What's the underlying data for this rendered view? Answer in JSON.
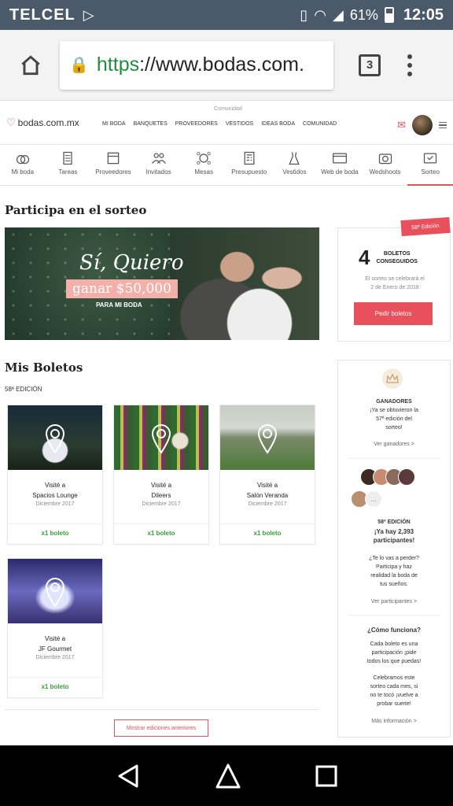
{
  "status_bar": {
    "carrier": "TELCEL",
    "battery": "61%",
    "time": "12:05"
  },
  "browser": {
    "url_scheme": "https",
    "url_rest": "://www.bodas.com.",
    "tab_count": "3"
  },
  "site": {
    "logo_text": "bodas.com.mx",
    "top_small": "Comunidad",
    "nav": [
      "MI BODA",
      "BANQUETES",
      "PROVEEDORES",
      "VESTIDOS",
      "IDEAS BODA",
      "COMUNIDAD"
    ]
  },
  "tools": [
    {
      "label": "Mi boda",
      "icon": "rings-icon"
    },
    {
      "label": "Tareas",
      "icon": "checklist-icon"
    },
    {
      "label": "Proveedores",
      "icon": "vendors-icon"
    },
    {
      "label": "Invitados",
      "icon": "guests-icon"
    },
    {
      "label": "Mesas",
      "icon": "tables-icon"
    },
    {
      "label": "Presupuesto",
      "icon": "budget-icon"
    },
    {
      "label": "Vestidos",
      "icon": "dress-icon"
    },
    {
      "label": "Web de boda",
      "icon": "website-icon"
    },
    {
      "label": "Wedshoots",
      "icon": "camera-icon"
    },
    {
      "label": "Sorteo",
      "icon": "ticket-icon"
    }
  ],
  "sorteo": {
    "heading": "Participa en el sorteo",
    "banner": {
      "line1": "Sí, Quiero",
      "line2": "ganar $50,000",
      "line3": "PARA MI BODA"
    },
    "edition_tag": "58ª Edición",
    "count": "4",
    "count_label_1": "BOLETOS",
    "count_label_2": "CONSEGUIDOS",
    "date_line_1": "El sorteo se celebrará el",
    "date_line_2": "2 de Enero de 2018",
    "pedir_button": "Pedir boletos"
  },
  "mis_boletos": {
    "heading": "Mis Boletos",
    "edition": "58ª EDICIÓN",
    "cards": [
      {
        "visit": "Visité a",
        "name": "Spacios Lounge",
        "date": "Diciembre 2017",
        "tickets": "x1 boleto"
      },
      {
        "visit": "Visité a",
        "name": "Dileers",
        "date": "Diciembre 2017",
        "tickets": "x1 boleto"
      },
      {
        "visit": "Visité a",
        "name": "Salón Veranda",
        "date": "Diciembre 2017",
        "tickets": "x1 boleto"
      },
      {
        "visit": "Visité a",
        "name": "JF Gourmet",
        "date": "Diciembre 2017",
        "tickets": "x1 boleto"
      }
    ],
    "more_button": "Mostrar ediciones anteriores"
  },
  "sidebar": {
    "ganadores_title": "GANADORES",
    "ganadores_text_1": "¡Ya se obtuvieron la",
    "ganadores_text_2": "57ª edición del",
    "ganadores_text_3": "sorteo!",
    "ganadores_link": "Ver ganadores >",
    "faces_more": "...",
    "edition": "58ª EDICIÓN",
    "participants_1": "¡Ya hay 2,393",
    "participants_2": "participantes!",
    "cta_1": "¿Te lo vas a perder?",
    "cta_2": "Participa y haz",
    "cta_3": "realidad la boda de",
    "cta_4": "tus sueños.",
    "participants_link": "Ver participantes >",
    "how_title": "¿Cómo funciona?",
    "how_1": "Cada boleto es una",
    "how_2": "participación ¡pide",
    "how_3": "todos los que puedas!",
    "how_4": "Celebramos este",
    "how_5": "sorteo cada mes, si",
    "how_6": "no te tocó ¡vuelve a",
    "how_7": "probar suerte!",
    "how_link": "Más información >"
  },
  "colors": {
    "accent": "#e8505b",
    "green": "#3a9d3a",
    "status_bar": "#4b5a6b"
  }
}
